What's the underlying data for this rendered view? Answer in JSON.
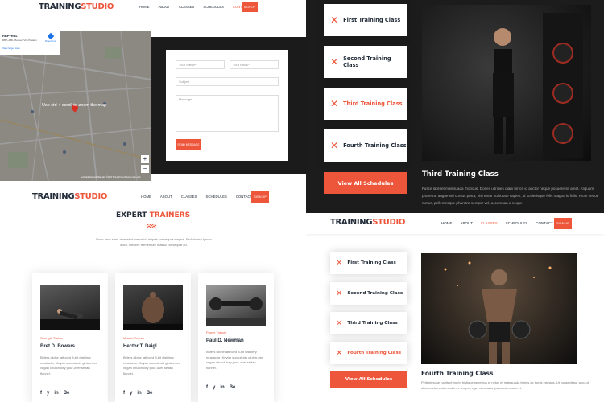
{
  "brand": {
    "left": "TRAINING",
    "right": "STUDIO",
    "accent": "#ed563b",
    "dark": "#232d39"
  },
  "nav_top": {
    "items": [
      "HOME",
      "ABOUT",
      "CLASSES",
      "SCHEDULES",
      "CONTACT"
    ],
    "active": "CONTACT",
    "signup": "SIGN UP"
  },
  "nav_mid": {
    "items": [
      "HOME",
      "ABOUT",
      "CLASSES",
      "SCHEDULES",
      "CONTACT"
    ],
    "signup": "SIGN UP"
  },
  "nav_right": {
    "items": [
      "HOME",
      "ABOUT",
      "CLASSES",
      "SCHEDULES",
      "CONTACT"
    ],
    "active": "CLASSES",
    "signup": "SIGN UP"
  },
  "map": {
    "place_title": "RBP+RBL",
    "place_sub": "RBP+RBL, Bosuer, Vila Pradem",
    "directions": "Directions",
    "larger_map": "View larger map",
    "zoom_hint": "Use ctrl + scroll to zoom the map",
    "zoom_in": "+",
    "zoom_out": "−",
    "footer": "Keyboard shortcuts   Map data ©2022   Terms of Use   Report a map error"
  },
  "contact_form": {
    "name_placeholder": "Your Name*",
    "email_placeholder": "Your Email*",
    "subject_placeholder": "Subject",
    "message_placeholder": "Message",
    "send_button": "SEND MESSAGE"
  },
  "trainers": {
    "title_left": "EXPERT",
    "title_right": "TRAINERS",
    "intro": "Nunc urna sem, laoreet ut metus id, aliquet consequat magna. Sed viverra ipsum dolor, ultricies fermentum massa consequat eu.",
    "list": [
      {
        "role": "Strength Trainer",
        "name": "Bret D. Bowers",
        "bio": "Bitters cliche tattooed 8-bit distillery mustache. Keytar succulents gluten-free vegan church-key pour-over seitan flannel."
      },
      {
        "role": "Muscle Trainer",
        "name": "Hector T. Daigl",
        "bio": "Bitters cliche tattooed 8-bit distillery mustache. Keytar succulents gluten-free vegan church-key pour-over seitan flannel."
      },
      {
        "role": "Power Trainer",
        "name": "Paul D. Newman",
        "bio": "Bitters cliche tattooed 8-bit distillery mustache. Keytar succulents gluten-free vegan church-key pour-over seitan flannel."
      }
    ],
    "social": [
      "f",
      "y",
      "in",
      "Be"
    ]
  },
  "schedule_top": {
    "classes": [
      "First Training Class",
      "Second Training Class",
      "Third Training Class",
      "Fourth Training Class"
    ],
    "active_index": 2,
    "view_all": "View All Schedules",
    "detail_title": "Third Training Class",
    "detail_text": "Fusce laoreet malesuada rhoncus. Donec ultricies diam tortor, id auctor neque posuere sit amet. Aliquam pharetra, augue vel cursus porta, nisi tortor vulputate sapien, id scelerisque felis magna id felis. Proin neque metus, pellentesque pharetra semper vel, accumsan a neque."
  },
  "schedule_bottom": {
    "classes": [
      "First Training Class",
      "Second Training Class",
      "Third Training Class",
      "Fourth Training Class"
    ],
    "active_index": 3,
    "view_all": "View All Schedules",
    "detail_title": "Fourth Training Class",
    "detail_text": "Pellentesque habitant morbi tristique senectus et netus et malesuada fames ac turpis egestas. Ut consectetur, arcu ut ultrices elementum odio ex tempor, eget venenatis ipsum commodo et."
  }
}
